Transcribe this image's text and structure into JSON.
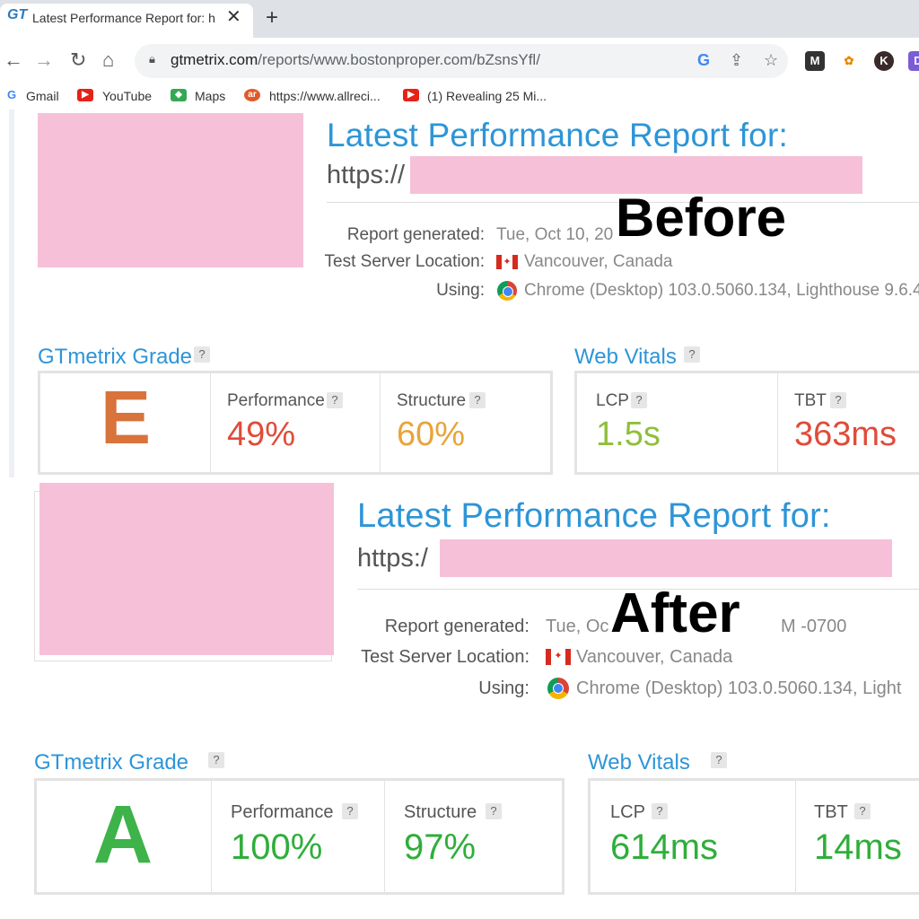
{
  "browser": {
    "tab": {
      "favicon": "GT",
      "title": "Latest Performance Report for: h",
      "close": "✕"
    },
    "new_tab": "+",
    "nav": {
      "back": "←",
      "forward": "→",
      "reload": "↻",
      "home": "⌂"
    },
    "url": {
      "host": "gtmetrix.com",
      "path": "/reports/www.bostonproper.com/bZsnsYfl/"
    },
    "omnibox_icons": [
      "google-icon",
      "share-icon",
      "star-icon"
    ],
    "extensions": [
      {
        "name": "m-extension-icon",
        "label": "M",
        "color": "#333333"
      },
      {
        "name": "flower-extension-icon",
        "label": "✿",
        "color": "#e58a00"
      },
      {
        "name": "profile-extension-icon",
        "label": "K",
        "color": "#3a2a2a"
      },
      {
        "name": "purple-extension-icon",
        "label": "D",
        "color": "#7b5cd6"
      }
    ],
    "bookmarks": [
      {
        "label": "Gmail",
        "icon": "G",
        "color": "#ffffff"
      },
      {
        "label": "YouTube",
        "icon": "▶",
        "color": "#e62117"
      },
      {
        "label": "Maps",
        "icon": "◆",
        "color": "#34a853"
      },
      {
        "label": "https://www.allreci...",
        "icon": "ar",
        "color": "#e05a2b"
      },
      {
        "label": "(1) Revealing 25 Mi...",
        "icon": "▶",
        "color": "#e62117"
      }
    ]
  },
  "before": {
    "heading": "Latest Performance Report for:",
    "url_prefix": "https://",
    "overlay": "Before",
    "report_generated_label": "Report generated:",
    "report_generated_value": "Tue, Oct 10, 20",
    "location_label": "Test Server Location:",
    "location_value": "Vancouver, Canada",
    "using_label": "Using:",
    "using_value": "Chrome (Desktop) 103.0.5060.134, Lighthouse 9.6.4",
    "grade_title": "GTmetrix Grade",
    "grade": "E",
    "performance_label": "Performance",
    "performance_value": "49%",
    "structure_label": "Structure",
    "structure_value": "60%",
    "vitals_title": "Web Vitals",
    "lcp_label": "LCP",
    "lcp_value": "1.5s",
    "tbt_label": "TBT",
    "tbt_value": "363ms"
  },
  "after": {
    "heading": "Latest Performance Report for:",
    "url_prefix": "https:/",
    "overlay": "After",
    "report_generated_label": "Report generated:",
    "report_generated_value": "Tue, Oc",
    "report_generated_tail": "M -0700",
    "location_label": "Test Server Location:",
    "location_value": "Vancouver, Canada",
    "using_label": "Using:",
    "using_value": "Chrome (Desktop) 103.0.5060.134, Light",
    "grade_title": "GTmetrix Grade",
    "grade": "A",
    "performance_label": "Performance",
    "performance_value": "100%",
    "structure_label": "Structure",
    "structure_value": "97%",
    "vitals_title": "Web Vitals",
    "lcp_label": "LCP",
    "lcp_value": "614ms",
    "tbt_label": "TBT",
    "tbt_value": "14ms"
  },
  "help_mark": "?",
  "colors": {
    "heading": "#2d95d7",
    "grade_e": "#d8733c",
    "grade_a": "#3db34a",
    "bad_red": "#e04b3a",
    "warn_orange": "#e8a43a",
    "good_green": "#8fbf3a",
    "great_green": "#2fae3a"
  }
}
